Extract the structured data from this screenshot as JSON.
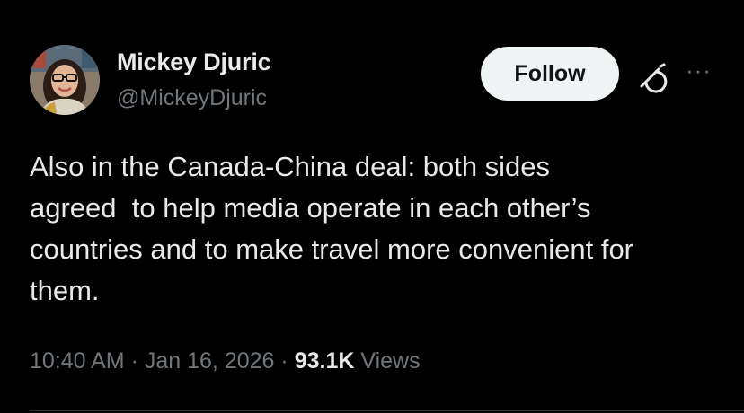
{
  "author": {
    "name": "Mickey Djuric",
    "handle": "@MickeyDjuric"
  },
  "follow_label": "Follow",
  "tweet": {
    "text": "Also in the Canada-China deal: both sides\nagreed  to help media operate in each other’s\ncountries and to make travel more convenient for\nthem."
  },
  "meta": {
    "time": "10:40 AM",
    "date": "Jan 16, 2026",
    "views_count": "93.1K",
    "views_label": "Views"
  },
  "icons": {
    "grok": "grok-icon",
    "more": "more-icon"
  }
}
